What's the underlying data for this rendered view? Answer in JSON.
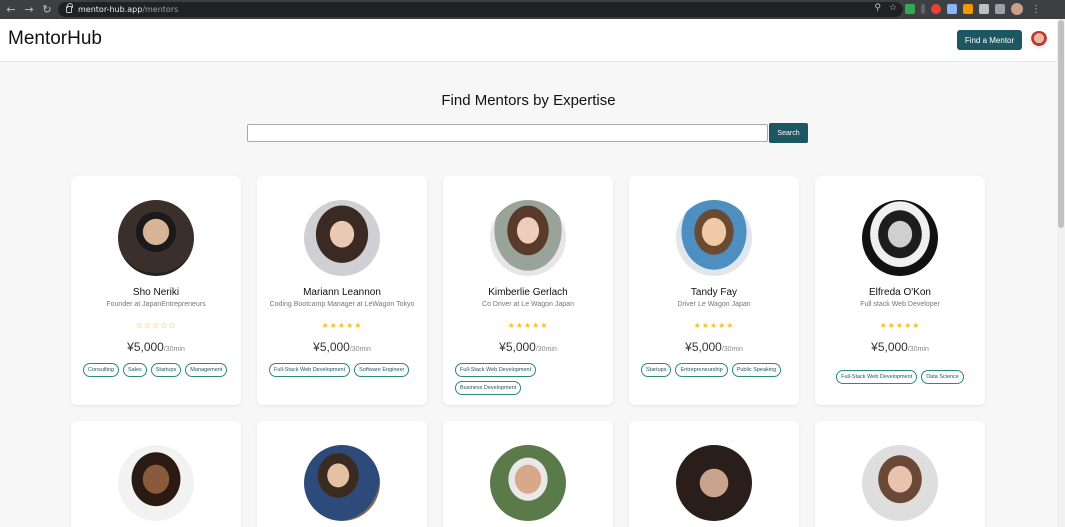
{
  "browser": {
    "url_host": "mentor-hub.app",
    "url_path": "/mentors"
  },
  "header": {
    "logo": "MentorHub",
    "find_button": "Find a Mentor"
  },
  "main": {
    "title": "Find Mentors by Expertise",
    "search_placeholder": "",
    "search_button": "Search"
  },
  "mentors": [
    {
      "name": "Sho Neriki",
      "role": "Founder at JapanEntrepreneurs",
      "stars": "☆☆☆☆☆",
      "rating": 0,
      "price": "¥5,000",
      "unit": "/30min",
      "tags": [
        "Consulting",
        "Sales",
        "Startups",
        "Management"
      ]
    },
    {
      "name": "Mariann Leannon",
      "role": "Coding Bootcamp Manager at LeWagon Tokyo",
      "stars": "★★★★★",
      "rating": 5,
      "price": "¥5,000",
      "unit": "/30min",
      "tags": [
        "Full-Stack Web Development",
        "Software Engineer"
      ]
    },
    {
      "name": "Kimberlie Gerlach",
      "role": "Co Driver at Le Wagon Japan",
      "stars": "★★★★★",
      "rating": 5,
      "price": "¥5,000",
      "unit": "/30min",
      "tags": [
        "Full-Stack Web Development",
        "Business Development"
      ]
    },
    {
      "name": "Tandy Fay",
      "role": "Driver Le Wagon Japan",
      "stars": "★★★★★",
      "rating": 5,
      "price": "¥5,000",
      "unit": "/30min",
      "tags": [
        "Startups",
        "Entrepreneurship",
        "Public Speaking"
      ]
    },
    {
      "name": "Elfreda O'Kon",
      "role": "Full stack Web Developer",
      "stars": "★★★★★",
      "rating": 5,
      "price": "¥5,000",
      "unit": "/30min",
      "tags": [
        "Full-Stack Web Development",
        "Data Science"
      ]
    }
  ],
  "colors": {
    "brand": "#1e5661",
    "tag_border": "#2a8c73",
    "star": "#f5c518"
  }
}
